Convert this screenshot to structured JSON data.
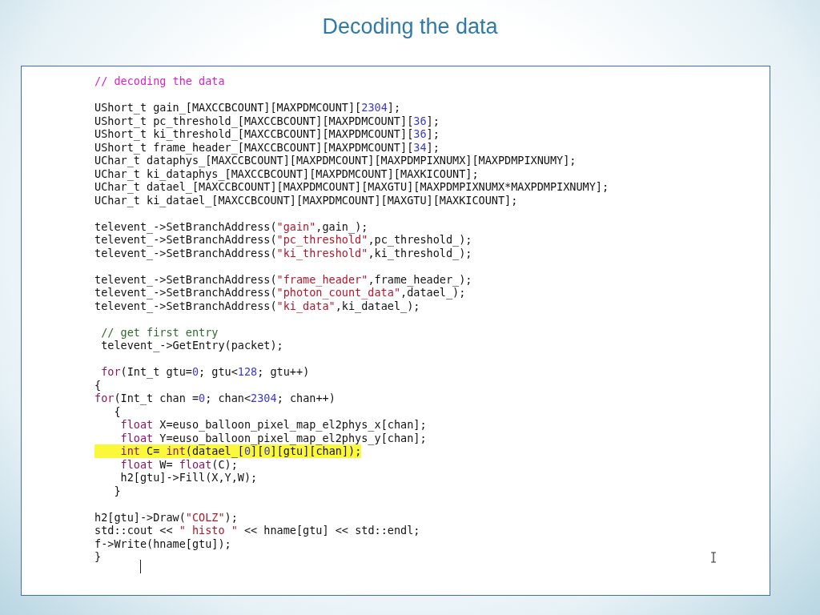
{
  "slide_title": "Decoding the data",
  "code_blocks": [
    [
      {
        "highlighted": false,
        "tokens": [
          {
            "kind": "section-comment",
            "text": "// decoding the data"
          }
        ]
      }
    ],
    [
      {
        "highlighted": false,
        "tokens": [
          {
            "kind": "plain",
            "text": "UShort_t gain_[MAXCCBCOUNT][MAXPDMCOUNT]["
          },
          {
            "kind": "number",
            "text": "2304"
          },
          {
            "kind": "plain",
            "text": "];"
          }
        ]
      },
      {
        "highlighted": false,
        "tokens": [
          {
            "kind": "plain",
            "text": "UShort_t pc_threshold_[MAXCCBCOUNT][MAXPDMCOUNT]["
          },
          {
            "kind": "number",
            "text": "36"
          },
          {
            "kind": "plain",
            "text": "];"
          }
        ]
      },
      {
        "highlighted": false,
        "tokens": [
          {
            "kind": "plain",
            "text": "UShort_t ki_threshold_[MAXCCBCOUNT][MAXPDMCOUNT]["
          },
          {
            "kind": "number",
            "text": "36"
          },
          {
            "kind": "plain",
            "text": "];"
          }
        ]
      },
      {
        "highlighted": false,
        "tokens": [
          {
            "kind": "plain",
            "text": "UShort_t frame_header_[MAXCCBCOUNT][MAXPDMCOUNT]["
          },
          {
            "kind": "number",
            "text": "34"
          },
          {
            "kind": "plain",
            "text": "];"
          }
        ]
      },
      {
        "highlighted": false,
        "tokens": [
          {
            "kind": "plain",
            "text": "UChar_t dataphys_[MAXCCBCOUNT][MAXPDMCOUNT][MAXPDMPIXNUMX][MAXPDMPIXNUMY];"
          }
        ]
      },
      {
        "highlighted": false,
        "tokens": [
          {
            "kind": "plain",
            "text": "UChar_t ki_dataphys_[MAXCCBCOUNT][MAXPDMCOUNT][MAXKICOUNT];"
          }
        ]
      },
      {
        "highlighted": false,
        "tokens": [
          {
            "kind": "plain",
            "text": "UChar_t datael_[MAXCCBCOUNT][MAXPDMCOUNT][MAXGTU][MAXPDMPIXNUMX*MAXPDMPIXNUMY];"
          }
        ]
      },
      {
        "highlighted": false,
        "tokens": [
          {
            "kind": "plain",
            "text": "UChar_t ki_datael_[MAXCCBCOUNT][MAXPDMCOUNT][MAXGTU][MAXKICOUNT];"
          }
        ]
      }
    ],
    [
      {
        "highlighted": false,
        "tokens": [
          {
            "kind": "plain",
            "text": "televent_->SetBranchAddress("
          },
          {
            "kind": "string",
            "text": "\"gain\""
          },
          {
            "kind": "plain",
            "text": ",gain_);"
          }
        ]
      },
      {
        "highlighted": false,
        "tokens": [
          {
            "kind": "plain",
            "text": "televent_->SetBranchAddress("
          },
          {
            "kind": "string",
            "text": "\"pc_threshold\""
          },
          {
            "kind": "plain",
            "text": ",pc_threshold_);"
          }
        ]
      },
      {
        "highlighted": false,
        "tokens": [
          {
            "kind": "plain",
            "text": "televent_->SetBranchAddress("
          },
          {
            "kind": "string",
            "text": "\"ki_threshold\""
          },
          {
            "kind": "plain",
            "text": ",ki_threshold_);"
          }
        ]
      }
    ],
    [
      {
        "highlighted": false,
        "tokens": [
          {
            "kind": "plain",
            "text": "televent_->SetBranchAddress("
          },
          {
            "kind": "string",
            "text": "\"frame_header\""
          },
          {
            "kind": "plain",
            "text": ",frame_header_);"
          }
        ]
      },
      {
        "highlighted": false,
        "tokens": [
          {
            "kind": "plain",
            "text": "televent_->SetBranchAddress("
          },
          {
            "kind": "string",
            "text": "\"photon_count_data\""
          },
          {
            "kind": "plain",
            "text": ",datael_);"
          }
        ]
      },
      {
        "highlighted": false,
        "tokens": [
          {
            "kind": "plain",
            "text": "televent_->SetBranchAddress("
          },
          {
            "kind": "string",
            "text": "\"ki_data\""
          },
          {
            "kind": "plain",
            "text": ",ki_datael_);"
          }
        ]
      }
    ],
    [
      {
        "highlighted": false,
        "tokens": [
          {
            "kind": "comment",
            "text": " // get first entry"
          }
        ]
      },
      {
        "highlighted": false,
        "tokens": [
          {
            "kind": "plain",
            "text": " televent_->GetEntry(packet);"
          }
        ]
      }
    ],
    [
      {
        "highlighted": false,
        "tokens": [
          {
            "kind": "keyword",
            "text": " for"
          },
          {
            "kind": "plain",
            "text": "(Int_t gtu="
          },
          {
            "kind": "number",
            "text": "0"
          },
          {
            "kind": "plain",
            "text": "; gtu<"
          },
          {
            "kind": "number",
            "text": "128"
          },
          {
            "kind": "plain",
            "text": "; gtu++)"
          }
        ]
      },
      {
        "highlighted": false,
        "tokens": [
          {
            "kind": "plain",
            "text": "{"
          }
        ]
      },
      {
        "highlighted": false,
        "tokens": [
          {
            "kind": "keyword",
            "text": "for"
          },
          {
            "kind": "plain",
            "text": "(Int_t chan ="
          },
          {
            "kind": "number",
            "text": "0"
          },
          {
            "kind": "plain",
            "text": "; chan<"
          },
          {
            "kind": "number",
            "text": "2304"
          },
          {
            "kind": "plain",
            "text": "; chan++)"
          }
        ]
      },
      {
        "highlighted": false,
        "tokens": [
          {
            "kind": "plain",
            "text": "   {"
          }
        ]
      },
      {
        "highlighted": false,
        "tokens": [
          {
            "kind": "keyword",
            "text": "    float"
          },
          {
            "kind": "plain",
            "text": " X=euso_balloon_pixel_map_el2phys_x[chan];"
          }
        ]
      },
      {
        "highlighted": false,
        "tokens": [
          {
            "kind": "keyword",
            "text": "    float"
          },
          {
            "kind": "plain",
            "text": " Y=euso_balloon_pixel_map_el2phys_y[chan];"
          }
        ]
      },
      {
        "highlighted": true,
        "tokens": [
          {
            "kind": "keyword",
            "text": "    int"
          },
          {
            "kind": "plain",
            "text": " C= "
          },
          {
            "kind": "keyword",
            "text": "int"
          },
          {
            "kind": "plain",
            "text": "(datael_["
          },
          {
            "kind": "number",
            "text": "0"
          },
          {
            "kind": "plain",
            "text": "]["
          },
          {
            "kind": "number",
            "text": "0"
          },
          {
            "kind": "plain",
            "text": "][gtu][chan]);"
          }
        ]
      },
      {
        "highlighted": false,
        "tokens": [
          {
            "kind": "keyword",
            "text": "    float"
          },
          {
            "kind": "plain",
            "text": " W= "
          },
          {
            "kind": "keyword",
            "text": "float"
          },
          {
            "kind": "plain",
            "text": "(C);"
          }
        ]
      },
      {
        "highlighted": false,
        "tokens": [
          {
            "kind": "plain",
            "text": "    h2[gtu]->Fill(X,Y,W);"
          }
        ]
      },
      {
        "highlighted": false,
        "tokens": [
          {
            "kind": "plain",
            "text": "   }"
          }
        ]
      }
    ],
    [
      {
        "highlighted": false,
        "tokens": [
          {
            "kind": "plain",
            "text": "h2[gtu]->Draw("
          },
          {
            "kind": "string",
            "text": "\"COLZ\""
          },
          {
            "kind": "plain",
            "text": ");"
          }
        ]
      },
      {
        "highlighted": false,
        "tokens": [
          {
            "kind": "plain",
            "text": "std::cout << "
          },
          {
            "kind": "string",
            "text": "\" histo \""
          },
          {
            "kind": "plain",
            "text": " << hname[gtu] << std::endl;"
          }
        ]
      },
      {
        "highlighted": false,
        "tokens": [
          {
            "kind": "plain",
            "text": "f->Write(hname[gtu]);"
          }
        ]
      },
      {
        "highlighted": false,
        "tokens": [
          {
            "kind": "plain",
            "text": "}"
          }
        ]
      }
    ]
  ]
}
